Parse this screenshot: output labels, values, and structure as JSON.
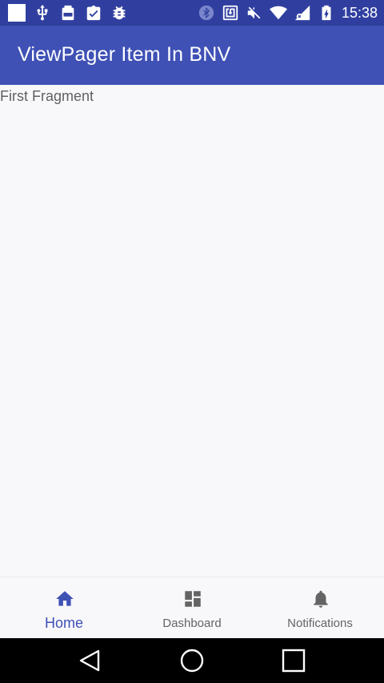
{
  "status_bar": {
    "time": "15:38",
    "left_icons": [
      "white-square-icon",
      "usb-icon",
      "battery-100-icon",
      "clipboard-check-icon",
      "android-bug-icon"
    ],
    "right_icons": [
      "bluetooth-icon",
      "nfc-icon",
      "mute-icon",
      "wifi-icon",
      "signal-icon",
      "battery-charging-icon"
    ],
    "colors": {
      "background": "#303f9f",
      "foreground": "#ffffff"
    }
  },
  "app_bar": {
    "title": "ViewPager Item In BNV",
    "color": "#3f51b5"
  },
  "content": {
    "text": "First Fragment"
  },
  "bottom_nav": {
    "active_color": "#3f51b5",
    "inactive_color": "#646464",
    "items": [
      {
        "label": "Home",
        "icon": "home-icon",
        "active": true
      },
      {
        "label": "Dashboard",
        "icon": "dashboard-icon",
        "active": false
      },
      {
        "label": "Notifications",
        "icon": "bell-icon",
        "active": false
      }
    ]
  },
  "system_nav": {
    "buttons": [
      "back-icon",
      "home-circle-icon",
      "recents-icon"
    ]
  }
}
